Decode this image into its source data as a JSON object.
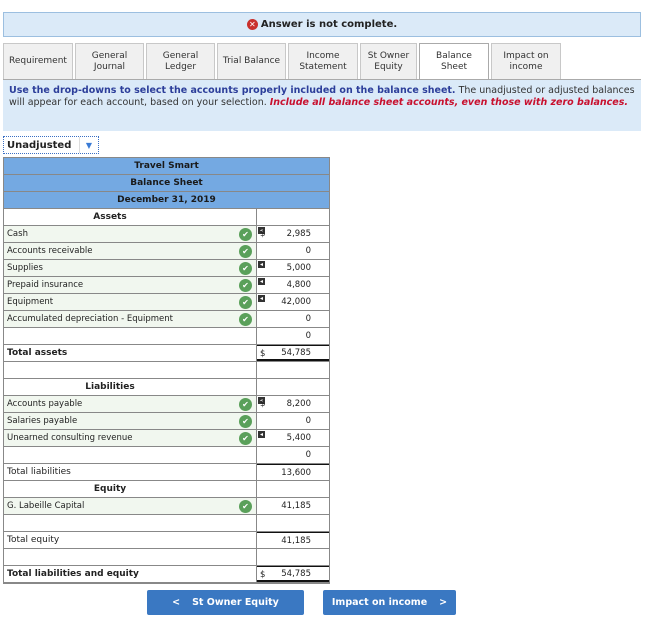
{
  "banner": {
    "icon": "error-circle-icon",
    "text": "Answer is not complete."
  },
  "tabs": [
    {
      "label": "Requirement",
      "w": 70
    },
    {
      "label": "General Journal",
      "w": 69
    },
    {
      "label": "General Ledger",
      "w": 69
    },
    {
      "label": "Trial Balance",
      "w": 69
    },
    {
      "label": "Income Statement",
      "w": 70
    },
    {
      "label": "St Owner Equity",
      "w": 57
    },
    {
      "label": "Balance Sheet",
      "w": 70,
      "active": true
    },
    {
      "label": "Impact on income",
      "w": 70
    }
  ],
  "instructions": {
    "bold": "Use the drop-downs to select the accounts properly included on the balance sheet.",
    "normal": " The unadjusted or adjusted balances will appear for each account, based on your selection. ",
    "red": "Include all balance sheet accounts, even those with zero balances."
  },
  "selector": {
    "value": "Unadjusted"
  },
  "sheet": {
    "rows": [
      {
        "type": "hdr",
        "label": "Travel Smart"
      },
      {
        "type": "hdr",
        "label": "Balance Sheet"
      },
      {
        "type": "hdr",
        "label": "December 31, 2019"
      },
      {
        "type": "sect",
        "label": "Assets"
      },
      {
        "type": "acct",
        "label": "Cash",
        "amount": "2,985",
        "check": true,
        "marker": true,
        "dollar": true
      },
      {
        "type": "acct",
        "label": "Accounts receivable",
        "amount": "0",
        "check": true
      },
      {
        "type": "acct",
        "label": "Supplies",
        "amount": "5,000",
        "check": true,
        "marker": true
      },
      {
        "type": "acct",
        "label": "Prepaid insurance",
        "amount": "4,800",
        "check": true,
        "marker": true
      },
      {
        "type": "acct",
        "label": "Equipment",
        "amount": "42,000",
        "check": true,
        "marker": true
      },
      {
        "type": "acct",
        "label": "Accumulated depreciation - Equipment",
        "amount": "0",
        "check": true
      },
      {
        "type": "blank",
        "label": "",
        "amount": "0"
      },
      {
        "type": "total",
        "label": "Total assets",
        "amount": "54,785",
        "bold": true,
        "dollar": true,
        "topb": true,
        "dbl": true
      },
      {
        "type": "blank",
        "label": ""
      },
      {
        "type": "sect",
        "label": "Liabilities"
      },
      {
        "type": "acct",
        "label": "Accounts payable",
        "amount": "8,200",
        "check": true,
        "marker": true,
        "dollar": true
      },
      {
        "type": "acct",
        "label": "Salaries payable",
        "amount": "0",
        "check": true
      },
      {
        "type": "acct",
        "label": "Unearned consulting revenue",
        "amount": "5,400",
        "check": true,
        "marker": true
      },
      {
        "type": "blank",
        "label": "",
        "amount": "0"
      },
      {
        "type": "total",
        "label": "Total liabilities",
        "amount": "13,600",
        "topb": true
      },
      {
        "type": "sect",
        "label": "Equity"
      },
      {
        "type": "acct",
        "label": "G. Labeille Capital",
        "amount": "41,185",
        "check": true
      },
      {
        "type": "blank",
        "label": ""
      },
      {
        "type": "total",
        "label": "Total equity",
        "amount": "41,185",
        "topb": true
      },
      {
        "type": "blank",
        "label": ""
      },
      {
        "type": "total",
        "label": "Total liabilities and equity",
        "amount": "54,785",
        "bold": true,
        "dollar": true,
        "topb": true,
        "dbl": true
      }
    ]
  },
  "nav": {
    "prev": "St Owner Equity",
    "next": "Impact on income"
  },
  "colors": {
    "header": "#74a9e2",
    "button": "#3a78c2",
    "check": "#5aa05a",
    "error": "#c9302c"
  }
}
